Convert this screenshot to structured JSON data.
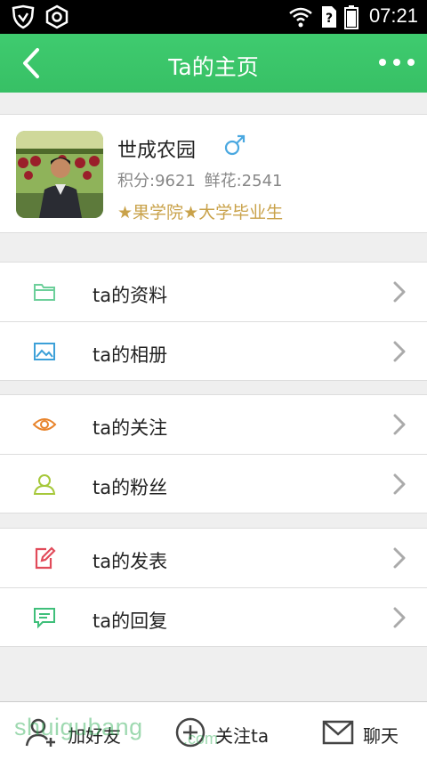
{
  "status_bar": {
    "time": "07:21"
  },
  "app_bar": {
    "title": "Ta的主页"
  },
  "profile": {
    "name": "世成农园",
    "gender_symbol": "♂",
    "points": "积分:9621",
    "flowers": "鲜花:2541",
    "tags": "★果学院★大学毕业生"
  },
  "menu_groups": [
    [
      {
        "label": "ta的资料",
        "icon": "folder-icon"
      },
      {
        "label": "ta的相册",
        "icon": "photo-icon"
      }
    ],
    [
      {
        "label": "ta的关注",
        "icon": "eye-icon"
      },
      {
        "label": "ta的粉丝",
        "icon": "person-icon"
      }
    ],
    [
      {
        "label": "ta的发表",
        "icon": "edit-icon"
      },
      {
        "label": "ta的回复",
        "icon": "comment-icon"
      }
    ]
  ],
  "bottom_bar": {
    "add_friend": "加好友",
    "follow": "关注ta",
    "chat": "聊天"
  },
  "watermark": {
    "text": "shuigubang",
    "sub": ".com"
  },
  "colors": {
    "accent": "#3dc66b",
    "tag_gold": "#c9a24a"
  }
}
